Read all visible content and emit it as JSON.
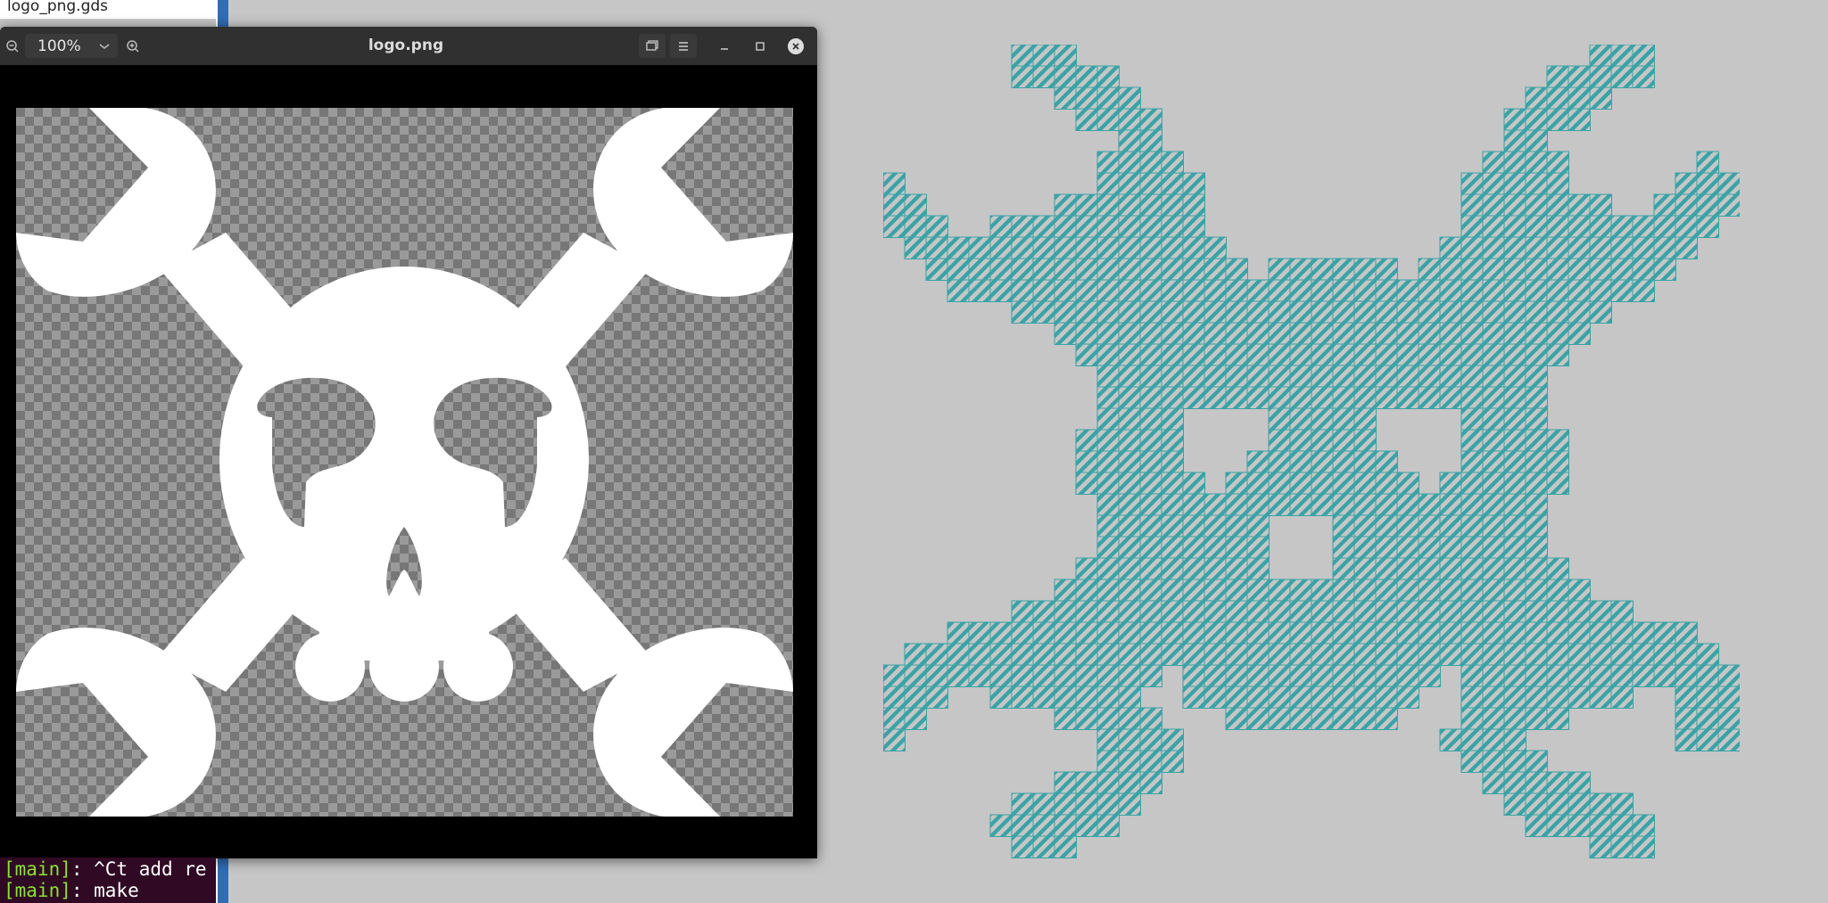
{
  "background_file_manager": {
    "filename": "logo_png.gds"
  },
  "terminal": {
    "lines": [
      {
        "branch": "[main]",
        "text": ": ^Ct add re"
      },
      {
        "branch": "[main]",
        "text": ": make"
      }
    ]
  },
  "viewer": {
    "title": "logo.png",
    "zoom": "100%",
    "icons": {
      "zoom_out": "zoom-out-icon",
      "zoom_in": "zoom-in-icon",
      "dropdown": "chevron-down-icon",
      "gallery": "gallery-icon",
      "menu": "hamburger-menu-icon",
      "minimize": "minimize-icon",
      "maximize": "maximize-icon",
      "close": "close-icon"
    }
  },
  "gds_layout": {
    "fill_color": "#4fb0b3",
    "hatch_color": "#2a9a9e"
  }
}
